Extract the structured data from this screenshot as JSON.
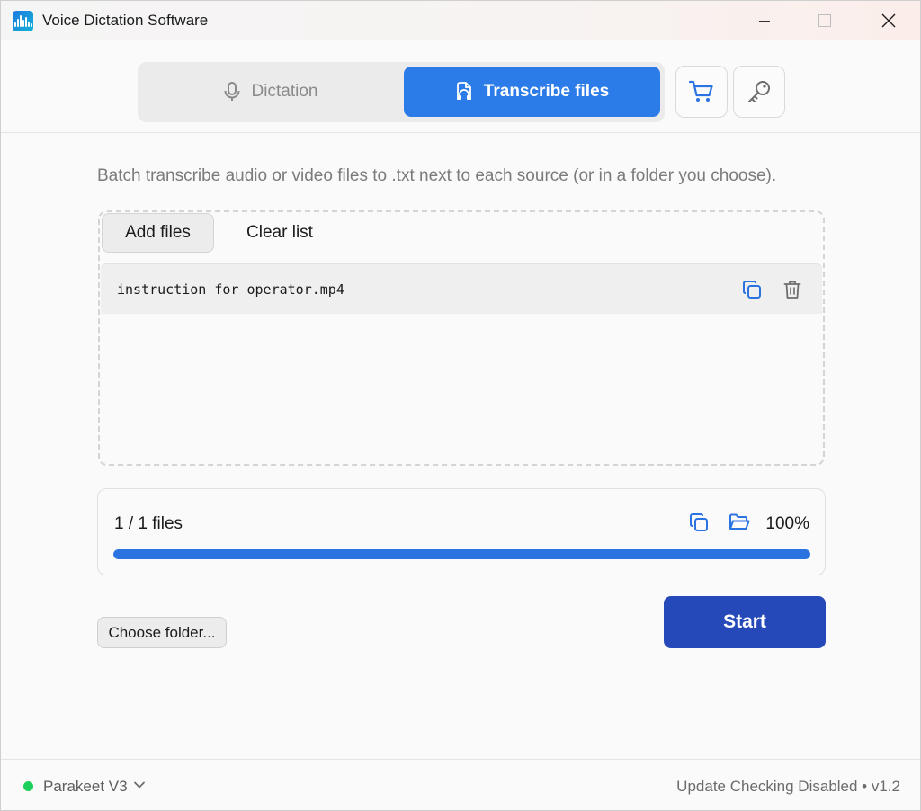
{
  "window": {
    "title": "Voice Dictation Software"
  },
  "tabs": {
    "dictation_label": "Dictation",
    "transcribe_label": "Transcribe files",
    "active": "transcribe"
  },
  "icons": {
    "cart": "cart-icon",
    "key": "key-icon",
    "microphone": "microphone-icon",
    "audio_file": "audio-file-icon",
    "copy": "copy-icon",
    "trash": "trash-icon",
    "folder": "folder-open-icon",
    "chevron": "chevron-down-icon"
  },
  "main": {
    "description": "Batch transcribe audio or video files to .txt next to each source (or in a folder you choose).",
    "add_files_label": "Add files",
    "clear_list_label": "Clear list",
    "files": [
      {
        "name": "instruction for operator.mp4"
      }
    ]
  },
  "progress": {
    "count_text": "1 / 1 files",
    "percent_text": "100%",
    "fraction": 1.0
  },
  "actions": {
    "choose_folder_label": "Choose folder...",
    "start_label": "Start"
  },
  "statusbar": {
    "model_name": "Parakeet V3",
    "model_status": "online",
    "right_text": "Update Checking Disabled • v1.2"
  },
  "colors": {
    "accent": "#2b7be8",
    "start_button": "#2549b8",
    "progress_fill": "#2b73e0",
    "status_online": "#1ccf5a",
    "icon_blue": "#2b73e0"
  }
}
